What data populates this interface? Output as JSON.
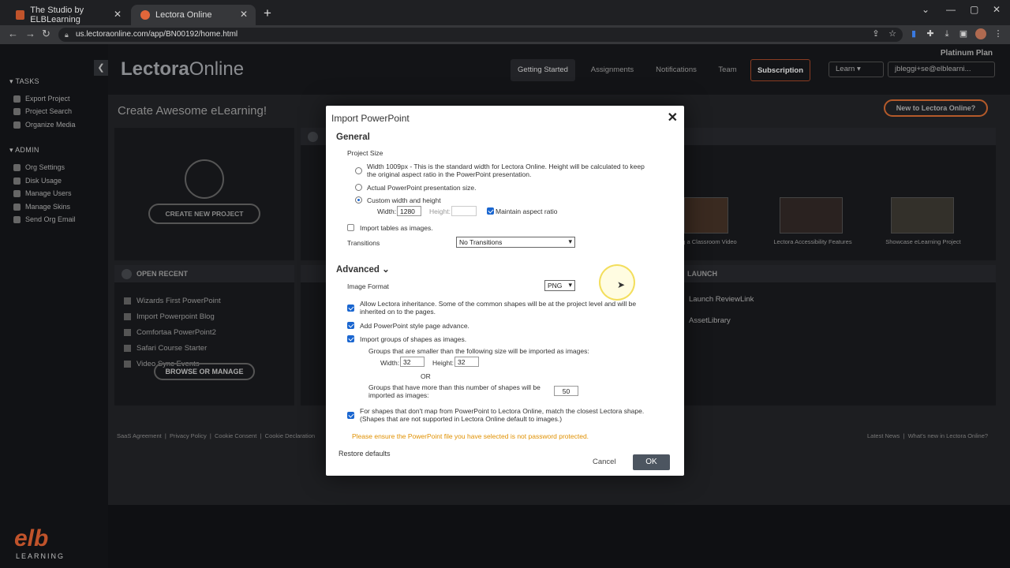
{
  "browser": {
    "tabs": [
      {
        "title": "The Studio by ELBLearning"
      },
      {
        "title": "Lectora Online"
      }
    ],
    "url": "us.lectoraonline.com/app/BN00192/home.html"
  },
  "sidebar": {
    "tasks_heading": "TASKS",
    "tasks": [
      "Export Project",
      "Project Search",
      "Organize Media"
    ],
    "admin_heading": "ADMIN",
    "admin": [
      "Org Settings",
      "Disk Usage",
      "Manage Users",
      "Manage Skins",
      "Send Org Email"
    ],
    "logo_text": "elb",
    "logo_sub": "LEARNING"
  },
  "header": {
    "brand_bold": "Lectora",
    "brand_light": "Online",
    "plan": "Platinum Plan",
    "nav": [
      "Getting Started",
      "Assignments",
      "Notifications",
      "Team",
      "Subscription"
    ],
    "learn": "Learn",
    "user": "jbleggi+se@elblearni..."
  },
  "content": {
    "welcome": "Create Awesome eLearning!",
    "new_button": "New to Lectora Online?",
    "create_new": "CREATE NEW PROJECT",
    "open_recent": "OPEN RECENT",
    "recent": [
      "Wizards First PowerPoint",
      "Import Powerpoint Blog",
      "Comfortaa PowerPoint2",
      "Safari Course Starter",
      "Video Sync Events"
    ],
    "browse": "BROWSE OR MANAGE",
    "thumbs": [
      "g a Classroom Video",
      "Lectora Accessibility Features",
      "Showcase eLearning Project"
    ],
    "launch_title": "LAUNCH",
    "launch": [
      "Launch ReviewLink",
      "AssetLibrary"
    ],
    "footer_left": [
      "SaaS Agreement",
      "Privacy Policy",
      "Cookie Consent",
      "Cookie Declaration"
    ],
    "footer_right": [
      "Latest News",
      "What's new in Lectora Online?"
    ]
  },
  "modal": {
    "title": "Import PowerPoint",
    "general": "General",
    "project_size": "Project Size",
    "opt_width_line1": "Width 1009px - This is the standard width for Lectora Online. Height will be calculated to keep",
    "opt_width_line2": "the original aspect ratio in the PowerPoint presentation.",
    "opt_actual": "Actual PowerPoint presentation size.",
    "opt_custom": "Custom width and height",
    "width_label": "Width:",
    "width_value": "1280",
    "height_label": "Height:",
    "height_value": "",
    "maintain": "Maintain aspect ratio",
    "import_tables": "Import tables as images.",
    "transitions_label": "Transitions",
    "transitions_value": "No Transitions",
    "advanced": "Advanced",
    "image_format_label": "Image Format",
    "image_format_value": "PNG",
    "inherit_line1": "Allow Lectora inheritance. Some of the common shapes will be at the project level and will be",
    "inherit_line2": "inherited on to the pages.",
    "page_advance": "Add PowerPoint style page advance.",
    "groups": "Import groups of shapes as images.",
    "groups_small": "Groups that are smaller than the following size will be imported as images:",
    "g_width_label": "Width:",
    "g_width": "32",
    "g_height_label": "Height:",
    "g_height": "32",
    "or": "OR",
    "groups_more_line1": "Groups that have more than this number of shapes will be",
    "groups_more_line2": "imported as images:",
    "groups_more_value": "50",
    "closest_line1": "For shapes that don't map from PowerPoint to Lectora Online, match the closest Lectora shape.",
    "closest_line2": "(Shapes that are not supported in Lectora Online default to images.)",
    "warning": "Please ensure the PowerPoint file you have selected is not password protected.",
    "restore": "Restore defaults",
    "cancel": "Cancel",
    "ok": "OK"
  }
}
